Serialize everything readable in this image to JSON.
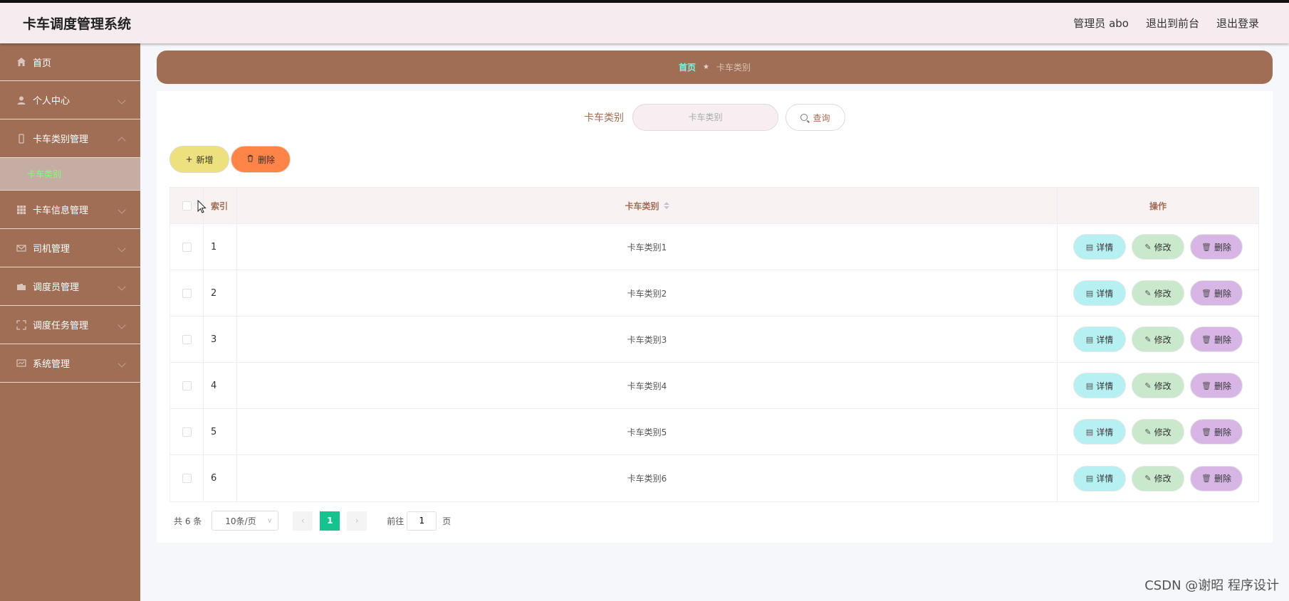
{
  "app": {
    "title": "卡车调度管理系统",
    "user_label": "管理员 abo",
    "to_front": "退出到前台",
    "logout": "退出登录"
  },
  "sidebar": {
    "items": [
      {
        "label": "首页",
        "icon": "home-icon"
      },
      {
        "label": "个人中心",
        "icon": "user-icon"
      },
      {
        "label": "卡车类别管理",
        "icon": "phone-icon",
        "expanded": true
      },
      {
        "label": "卡车信息管理",
        "icon": "grid-icon"
      },
      {
        "label": "司机管理",
        "icon": "mail-icon"
      },
      {
        "label": "调度员管理",
        "icon": "folder-icon"
      },
      {
        "label": "调度任务管理",
        "icon": "fullscreen-icon"
      },
      {
        "label": "系统管理",
        "icon": "monitor-icon"
      }
    ],
    "submenu_active": "卡车类别"
  },
  "breadcrumb": {
    "home": "首页",
    "current": "卡车类别"
  },
  "search": {
    "label": "卡车类别",
    "placeholder": "卡车类别",
    "query_label": "查询"
  },
  "actions": {
    "add_label": "新增",
    "delete_label": "删除"
  },
  "table": {
    "headers": {
      "index": "索引",
      "category": "卡车类别",
      "ops": "操作"
    },
    "rows": [
      {
        "index": "1",
        "category": "卡车类别1"
      },
      {
        "index": "2",
        "category": "卡车类别2"
      },
      {
        "index": "3",
        "category": "卡车类别3"
      },
      {
        "index": "4",
        "category": "卡车类别4"
      },
      {
        "index": "5",
        "category": "卡车类别5"
      },
      {
        "index": "6",
        "category": "卡车类别6"
      }
    ],
    "op_labels": {
      "detail": "详情",
      "edit": "修改",
      "delete": "删除"
    }
  },
  "pagination": {
    "total": "共 6 条",
    "page_size": "10条/页",
    "current_page": "1",
    "goto_label": "前往",
    "goto_value": "1",
    "page_suffix": "页"
  },
  "watermark": "CSDN @谢昭  程序设计",
  "colors": {
    "sidebar": "#a06e55",
    "header_bg": "#f6ecef",
    "accent_green": "#16c28e",
    "detail_btn": "#b7f0f2",
    "edit_btn": "#c9e8cc",
    "delete_btn": "#d7b6e6",
    "add_btn": "#ede07f",
    "batch_delete_btn": "#ff8448"
  }
}
